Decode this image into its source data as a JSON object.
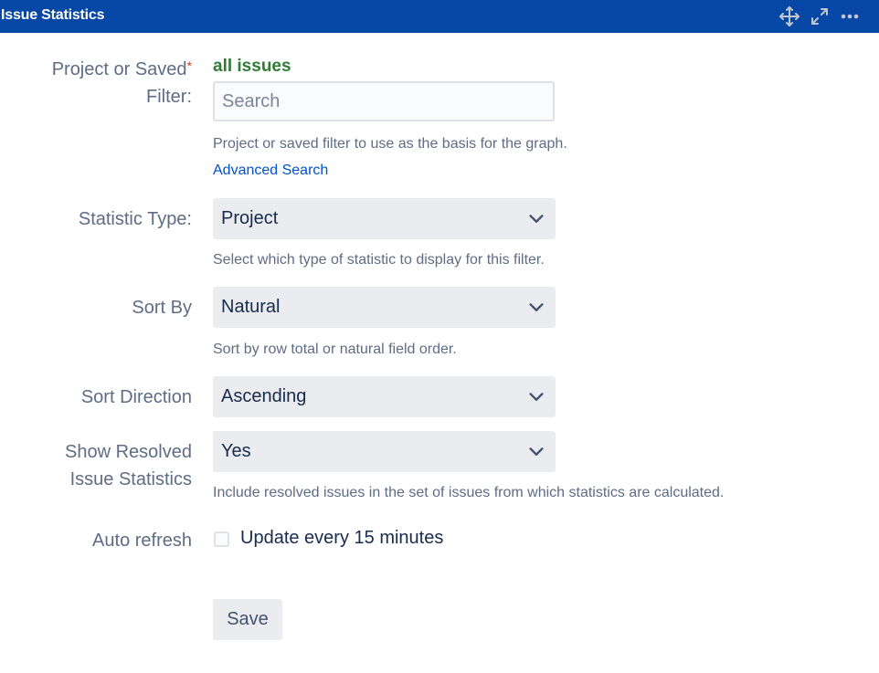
{
  "header": {
    "title": "Issue Statistics",
    "icons": [
      "move-icon",
      "expand-icon",
      "more-options-icon"
    ]
  },
  "form": {
    "filter": {
      "label": "Project or Saved",
      "label_line2": "Filter:",
      "required_marker": "*",
      "selected_value": "all issues",
      "search_placeholder": "Search",
      "help": "Project or saved filter to use as the basis for the graph.",
      "advanced_link": "Advanced Search"
    },
    "statistic_type": {
      "label": "Statistic Type:",
      "value": "Project",
      "help": "Select which type of statistic to display for this filter."
    },
    "sort_by": {
      "label": "Sort By",
      "value": "Natural",
      "help": "Sort by row total or natural field order."
    },
    "sort_direction": {
      "label": "Sort Direction",
      "value": "Ascending"
    },
    "show_resolved": {
      "label": "Show Resolved",
      "label_line2": "Issue Statistics",
      "value": "Yes",
      "help": "Include resolved issues in the set of issues from which statistics are calculated."
    },
    "auto_refresh": {
      "label": "Auto refresh",
      "checkbox_label": "Update every 15 minutes",
      "checked": false
    },
    "save_label": "Save"
  },
  "colors": {
    "header_bg": "#0747a6",
    "selected_filter": "#2e7d32",
    "link": "#0052cc",
    "required": "#de350b"
  }
}
